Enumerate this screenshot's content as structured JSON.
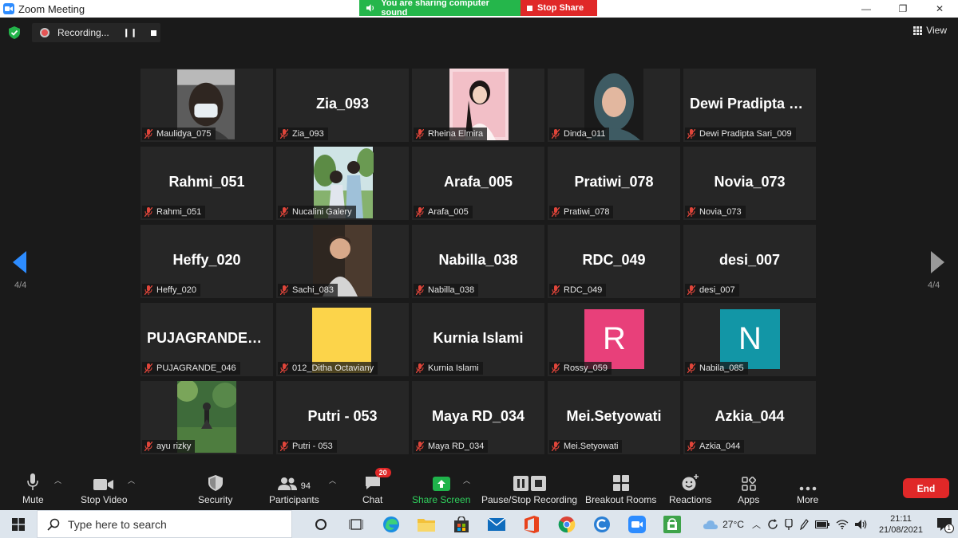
{
  "window": {
    "title": "Zoom Meeting",
    "minimize": "—",
    "restore": "❐",
    "close": "✕"
  },
  "share_banner": {
    "status": "You are sharing computer sound",
    "stop": "Stop Share"
  },
  "recording": {
    "label": "Recording..."
  },
  "view": {
    "label": "View"
  },
  "pages": {
    "left": "4/4",
    "right": "4/4"
  },
  "participants": [
    {
      "tile": "",
      "label": "Maulidya_075",
      "photo": "mask"
    },
    {
      "tile": "Zia_093",
      "label": "Zia_093"
    },
    {
      "tile": "",
      "label": "Rheina Elmira",
      "photo": "pink"
    },
    {
      "tile": "",
      "label": "Dinda_011",
      "photo": "hijab"
    },
    {
      "tile": "Dewi Pradipta S...",
      "label": "Dewi Pradipta Sari_009"
    },
    {
      "tile": "Rahmi_051",
      "label": "Rahmi_051"
    },
    {
      "tile": "",
      "label": "Nucalini Galery",
      "photo": "couple"
    },
    {
      "tile": "Arafa_005",
      "label": "Arafa_005"
    },
    {
      "tile": "Pratiwi_078",
      "label": "Pratiwi_078"
    },
    {
      "tile": "Novia_073",
      "label": "Novia_073"
    },
    {
      "tile": "Heffy_020",
      "label": "Heffy_020"
    },
    {
      "tile": "",
      "label": "Sachi_083",
      "photo": "child"
    },
    {
      "tile": "Nabilla_038",
      "label": "Nabilla_038"
    },
    {
      "tile": "RDC_049",
      "label": "RDC_049"
    },
    {
      "tile": "desi_007",
      "label": "desi_007"
    },
    {
      "tile": "PUJAGRANDE_...",
      "label": "PUJAGRANDE_046"
    },
    {
      "tile": "",
      "label": "012_Ditha Octaviany",
      "photo": "yellow"
    },
    {
      "tile": "Kurnia Islami",
      "label": "Kurnia Islami"
    },
    {
      "tile": "",
      "label": "Rossy_059",
      "avatar": "R",
      "avatar_color": "#e8407a"
    },
    {
      "tile": "",
      "label": "Nabila_085",
      "avatar": "N",
      "avatar_color": "#1296a6"
    },
    {
      "tile": "",
      "label": "ayu rizky",
      "photo": "garden"
    },
    {
      "tile": "Putri - 053",
      "label": "Putri - 053"
    },
    {
      "tile": "Maya RD_034",
      "label": "Maya RD_034"
    },
    {
      "tile": "Mei.Setyowati",
      "label": "Mei.Setyowati"
    },
    {
      "tile": "Azkia_044",
      "label": "Azkia_044"
    }
  ],
  "toolbar": {
    "mute": "Mute",
    "stop_video": "Stop Video",
    "security": "Security",
    "participants": "Participants",
    "participants_count": "94",
    "chat": "Chat",
    "chat_badge": "20",
    "share_screen": "Share Screen",
    "pause_stop_recording": "Pause/Stop Recording",
    "breakout_rooms": "Breakout Rooms",
    "reactions": "Reactions",
    "apps": "Apps",
    "more": "More",
    "end": "End"
  },
  "taskbar": {
    "search_placeholder": "Type here to search",
    "temperature": "27°C",
    "time": "21:11",
    "date": "21/08/2021",
    "notification_count": "1"
  },
  "colors": {
    "share_green": "#25b64b",
    "share_red": "#e02828",
    "share_icon": "#1fb34b",
    "end_red": "#e02828"
  }
}
